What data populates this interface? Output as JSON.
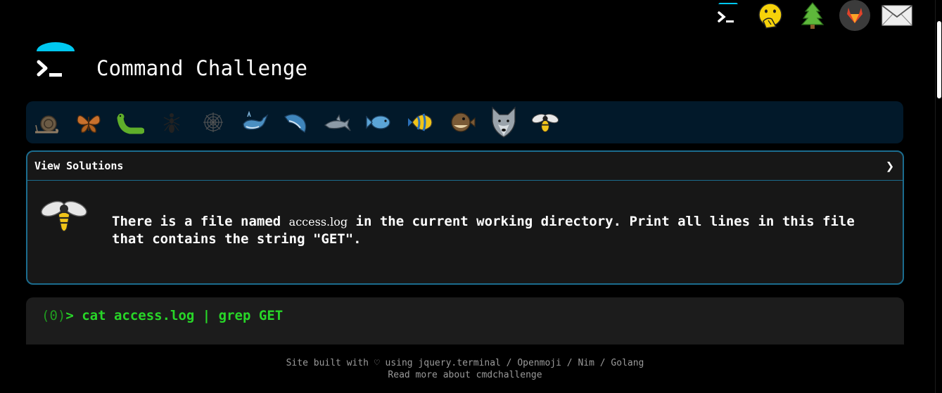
{
  "nav": {
    "items": [
      {
        "name": "terminal-logo-link"
      },
      {
        "name": "hand-over-mouth-emoji"
      },
      {
        "name": "tree-emoji"
      },
      {
        "name": "gitlab-icon"
      },
      {
        "name": "mail-icon"
      }
    ]
  },
  "header": {
    "title": "Command Challenge"
  },
  "challenges": {
    "items": [
      "snail",
      "butterfly",
      "caterpillar",
      "ant",
      "spider-web",
      "whale",
      "spouting-whale",
      "dolphin",
      "fish",
      "tropical-fish",
      "blowfish",
      "wolf",
      "bee"
    ]
  },
  "panel": {
    "title": "View Solutions",
    "chevron": "❯",
    "desc_part1": "There is a file named ",
    "desc_code": "access.log",
    "desc_part2": " in the current working directory. Print all lines in this file that contains the string \"GET\"."
  },
  "terminal": {
    "prompt": "(0)",
    "arrow": "> ",
    "command": "cat access.log | grep GET"
  },
  "footer": {
    "line1_prefix": "Site built with ♡ using ",
    "link_jquery": "jquery.terminal",
    "sep": " / ",
    "link_openmoji": "Openmoji",
    "link_nim": "Nim",
    "link_golang": "Golang",
    "line2": "Read more about cmdchallenge"
  },
  "colors": {
    "accent": "#1b6c8e",
    "logo_blue": "#00c8f0",
    "terminal_green": "#28d628"
  }
}
